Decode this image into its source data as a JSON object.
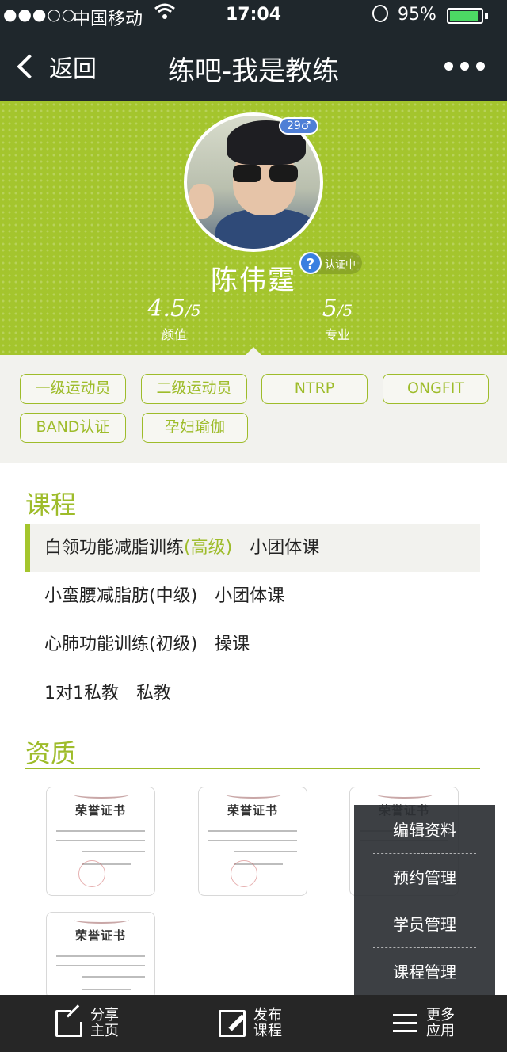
{
  "status_bar": {
    "signal": "●●●○○",
    "carrier": "中国移动",
    "time": "17:04",
    "battery_percent": "95%",
    "battery_level": 0.95
  },
  "nav": {
    "back_label": "返回",
    "title": "练吧-我是教练",
    "more_icon": "more-dots-icon"
  },
  "profile": {
    "age_badge": "29♂",
    "name": "陈伟霆",
    "verify_mark": "?",
    "verify_label": "认证中",
    "stats": [
      {
        "value": "4.5",
        "denominator": "/5",
        "label": "颜值"
      },
      {
        "value": "5",
        "denominator": "/5",
        "label": "专业"
      }
    ]
  },
  "tags": [
    "一级运动员",
    "二级运动员",
    "NTRP",
    "ONGFIT",
    "BAND认证",
    "孕妇瑜伽"
  ],
  "courses": {
    "title": "课程",
    "items": [
      {
        "name": "白领功能减脂训练",
        "level": "(高级)",
        "kind": "小团体课",
        "active": true
      },
      {
        "name": "小蛮腰减脂肪(中级)",
        "level": "",
        "kind": "小团体课",
        "active": false
      },
      {
        "name": "心肺功能训练(初级)",
        "level": "",
        "kind": "操课",
        "active": false
      },
      {
        "name": "1对1私教",
        "level": "",
        "kind": "私教",
        "active": false
      }
    ]
  },
  "qualifications": {
    "title": "资质",
    "cert_title": "荣誉证书"
  },
  "popup_menu": [
    "编辑资料",
    "预约管理",
    "学员管理",
    "课程管理"
  ],
  "tabbar": [
    {
      "icon": "share-icon",
      "line1": "分享",
      "line2": "主页"
    },
    {
      "icon": "edit-icon",
      "line1": "发布",
      "line2": "课程"
    },
    {
      "icon": "menu-icon",
      "line1": "更多",
      "line2": "应用"
    }
  ],
  "colors": {
    "accent": "#a4c52d",
    "nav_bg": "#1f272c",
    "tabbar_bg": "#262626",
    "tag_area_bg": "#f2f2ee",
    "verify_blue": "#3a7fe0"
  }
}
